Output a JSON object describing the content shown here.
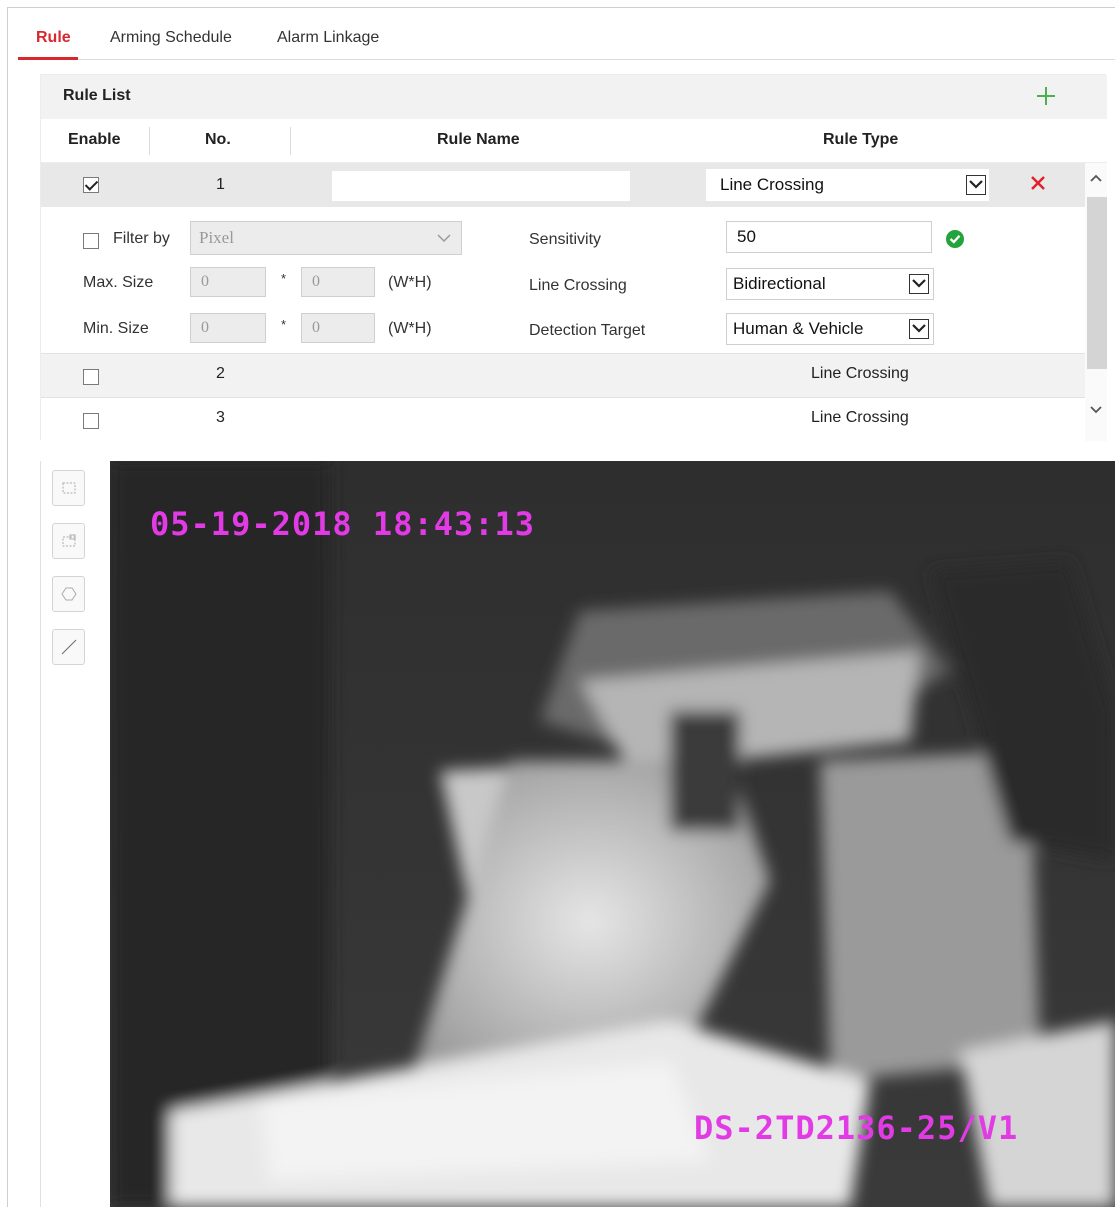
{
  "tabs": [
    {
      "label": "Rule"
    },
    {
      "label": "Arming Schedule"
    },
    {
      "label": "Alarm Linkage"
    }
  ],
  "rule_list": {
    "title": "Rule List",
    "columns": {
      "enable": "Enable",
      "no": "No.",
      "rule_name": "Rule Name",
      "rule_type": "Rule Type"
    },
    "rows": [
      {
        "no": "1",
        "rule_type": "Line Crossing",
        "enabled": true
      },
      {
        "no": "2",
        "rule_type": "Line Crossing",
        "enabled": false
      },
      {
        "no": "3",
        "rule_type": "Line Crossing",
        "enabled": false
      }
    ]
  },
  "detail": {
    "filter_by_label": "Filter by",
    "filter_by_value": "Pixel",
    "max_size_label": "Max. Size",
    "min_size_label": "Min. Size",
    "max_w": "0",
    "max_h": "0",
    "min_w": "0",
    "min_h": "0",
    "star": "*",
    "wh_unit": "(W*H)",
    "sensitivity_label": "Sensitivity",
    "sensitivity_value": "50",
    "line_crossing_label": "Line Crossing",
    "line_crossing_value": "Bidirectional",
    "detection_target_label": "Detection Target",
    "detection_target_value": "Human & Vehicle"
  },
  "video": {
    "timestamp": "05-19-2018 18:43:13",
    "model": "DS-2TD2136-25/V1"
  },
  "colors": {
    "accent": "#d8272f",
    "add": "#4caf50",
    "osd": "#e23be6"
  }
}
